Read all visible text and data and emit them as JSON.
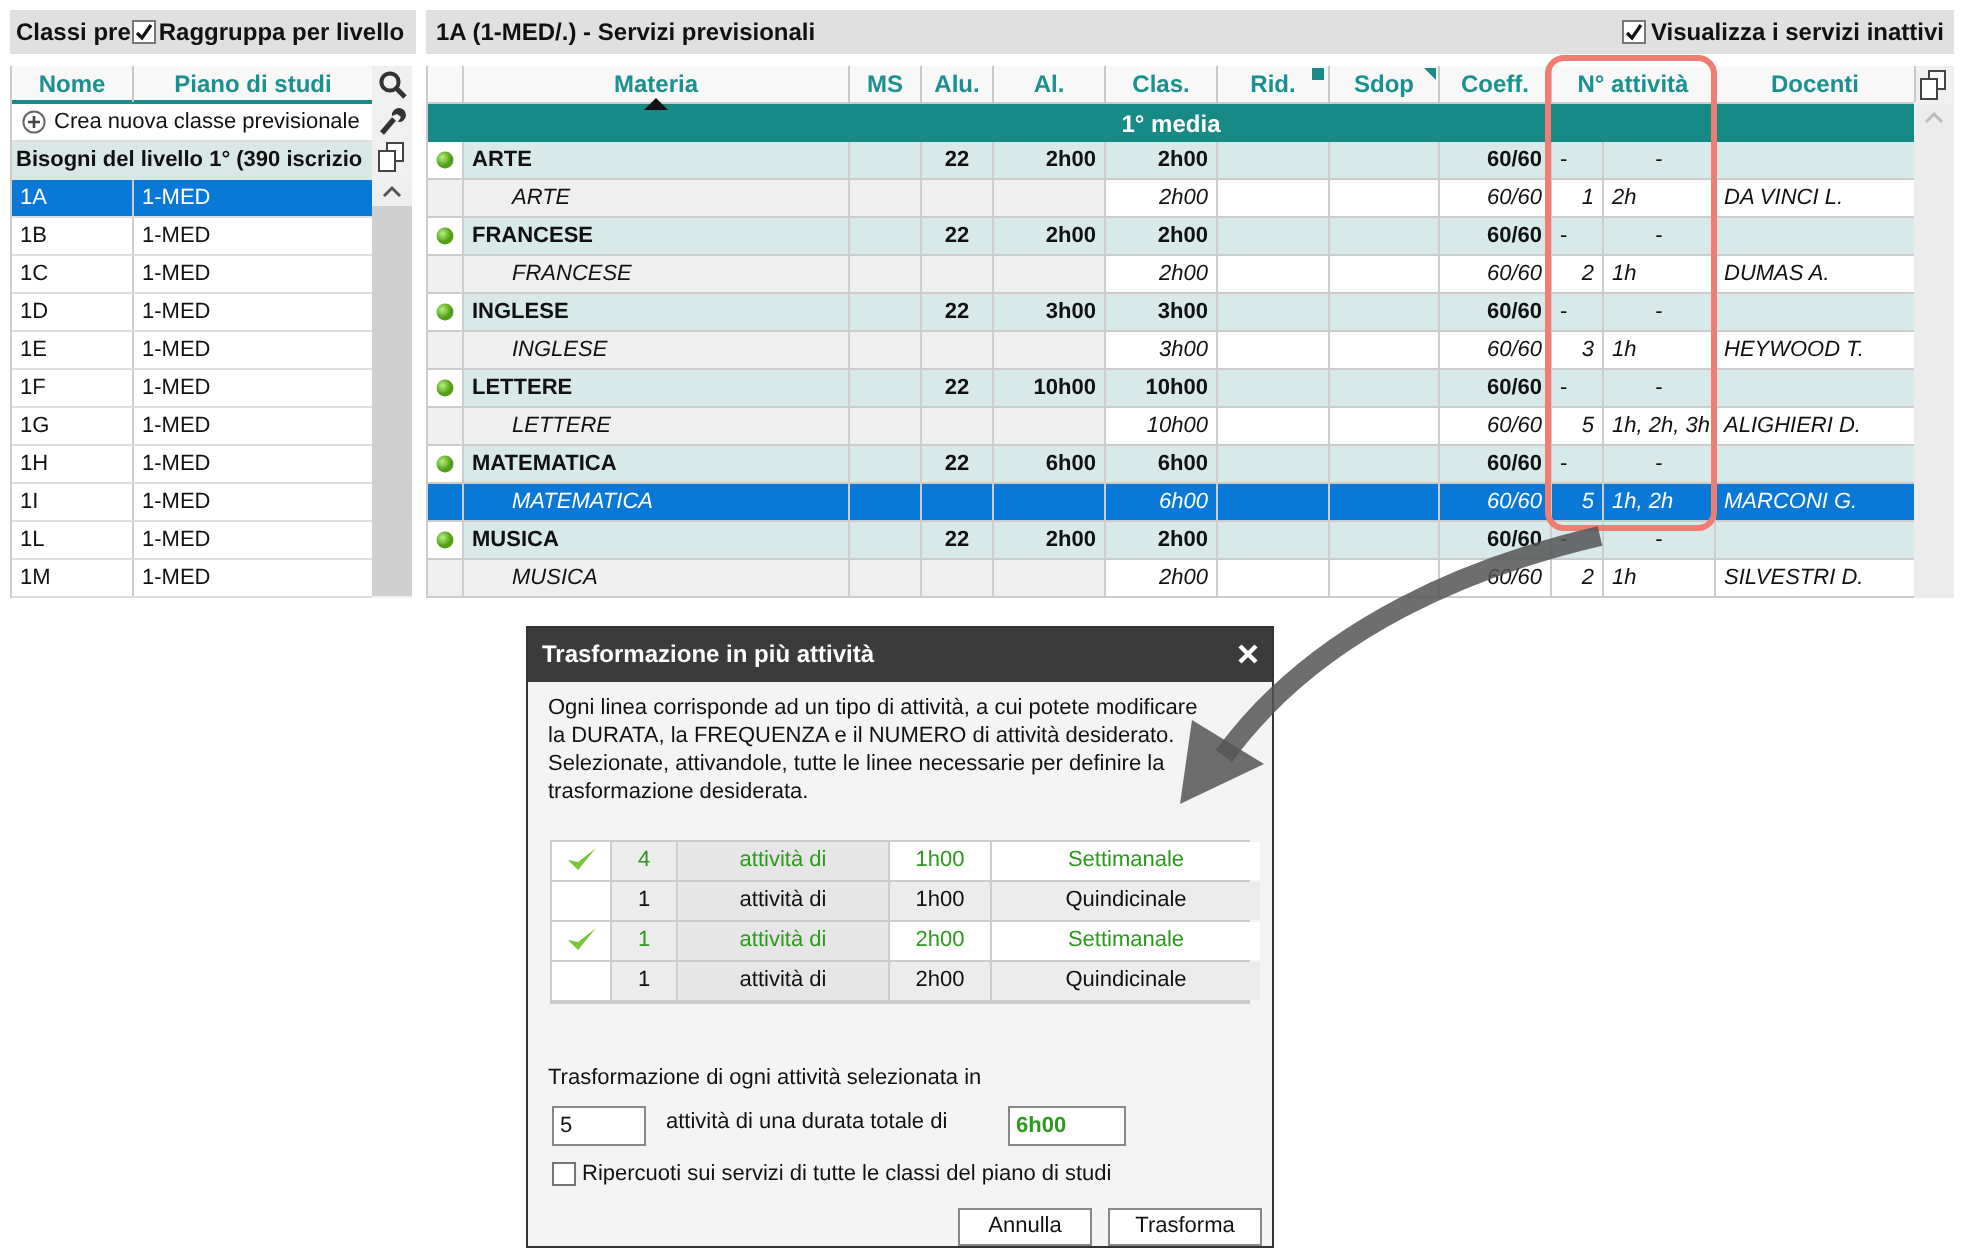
{
  "left_panel": {
    "title": "Classi pre",
    "group_checkbox": {
      "label": "Raggruppa per livello",
      "checked": true
    },
    "columns": [
      "Nome",
      "Piano di studi"
    ],
    "create_button": "Crea nuova classe previsionale",
    "group_row": "Bisogni del livello 1° (390 iscrizio",
    "rows": [
      {
        "name": "1A",
        "plan": "1-MED",
        "selected": true
      },
      {
        "name": "1B",
        "plan": "1-MED",
        "selected": false
      },
      {
        "name": "1C",
        "plan": "1-MED",
        "selected": false
      },
      {
        "name": "1D",
        "plan": "1-MED",
        "selected": false
      },
      {
        "name": "1E",
        "plan": "1-MED",
        "selected": false
      },
      {
        "name": "1F",
        "plan": "1-MED",
        "selected": false
      },
      {
        "name": "1G",
        "plan": "1-MED",
        "selected": false
      },
      {
        "name": "1H",
        "plan": "1-MED",
        "selected": false
      },
      {
        "name": "1I",
        "plan": "1-MED",
        "selected": false
      },
      {
        "name": "1L",
        "plan": "1-MED",
        "selected": false
      },
      {
        "name": "1M",
        "plan": "1-MED",
        "selected": false
      }
    ]
  },
  "right_panel": {
    "title": "1A (1-MED/.) - Servizi previsionali",
    "inactive_checkbox": {
      "label": "Visualizza i servizi inattivi",
      "checked": true
    },
    "columns": [
      "Materia",
      "MS",
      "Alu.",
      "Al.",
      "Clas.",
      "Rid.",
      "Sdop",
      "Coeff.",
      "N° attività",
      "Docenti"
    ],
    "group_header": "1° media",
    "rows": [
      {
        "kind": "subject",
        "subject": "ARTE",
        "alu": "22",
        "al": "2h00",
        "clas": "2h00",
        "coeff": "60/60",
        "count": "-",
        "durations": "-",
        "selected": false
      },
      {
        "kind": "service",
        "subject": "ARTE",
        "clas": "2h00",
        "coeff": "60/60",
        "count": "1",
        "durations": "2h",
        "teacher": "DA VINCI L.",
        "selected": false
      },
      {
        "kind": "subject",
        "subject": "FRANCESE",
        "alu": "22",
        "al": "2h00",
        "clas": "2h00",
        "coeff": "60/60",
        "count": "-",
        "durations": "-",
        "selected": false
      },
      {
        "kind": "service",
        "subject": "FRANCESE",
        "clas": "2h00",
        "coeff": "60/60",
        "count": "2",
        "durations": "1h",
        "teacher": "DUMAS A.",
        "selected": false
      },
      {
        "kind": "subject",
        "subject": "INGLESE",
        "alu": "22",
        "al": "3h00",
        "clas": "3h00",
        "coeff": "60/60",
        "count": "-",
        "durations": "-",
        "selected": false
      },
      {
        "kind": "service",
        "subject": "INGLESE",
        "clas": "3h00",
        "coeff": "60/60",
        "count": "3",
        "durations": "1h",
        "teacher": "HEYWOOD T.",
        "selected": false
      },
      {
        "kind": "subject",
        "subject": "LETTERE",
        "alu": "22",
        "al": "10h00",
        "clas": "10h00",
        "coeff": "60/60",
        "count": "-",
        "durations": "-",
        "selected": false
      },
      {
        "kind": "service",
        "subject": "LETTERE",
        "clas": "10h00",
        "coeff": "60/60",
        "count": "5",
        "durations": "1h, 2h, 3h",
        "teacher": "ALIGHIERI D.",
        "selected": false
      },
      {
        "kind": "subject",
        "subject": "MATEMATICA",
        "alu": "22",
        "al": "6h00",
        "clas": "6h00",
        "coeff": "60/60",
        "count": "-",
        "durations": "-",
        "selected": false
      },
      {
        "kind": "service",
        "subject": "MATEMATICA",
        "clas": "6h00",
        "coeff": "60/60",
        "count": "5",
        "durations": "1h, 2h",
        "teacher": "MARCONI G.",
        "selected": true
      },
      {
        "kind": "subject",
        "subject": "MUSICA",
        "alu": "22",
        "al": "2h00",
        "clas": "2h00",
        "coeff": "60/60",
        "count": "-",
        "durations": "-",
        "selected": false
      },
      {
        "kind": "service",
        "subject": "MUSICA",
        "clas": "2h00",
        "coeff": "60/60",
        "count": "2",
        "durations": "1h",
        "teacher": "SILVESTRI D.",
        "selected": false
      }
    ]
  },
  "dialog": {
    "title": "Trasformazione in più attività",
    "description": "Ogni linea corrisponde ad un tipo di attività, a cui potete modificare la DURATA, la FREQUENZA e il NUMERO di attività desiderato. Selezionate, attivandole, tutte le linee necessarie per definire la trasformazione desiderata.",
    "options": [
      {
        "checked": true,
        "count": "4",
        "label": "attività di",
        "duration": "1h00",
        "frequency": "Settimanale"
      },
      {
        "checked": false,
        "count": "1",
        "label": "attività di",
        "duration": "1h00",
        "frequency": "Quindicinale"
      },
      {
        "checked": true,
        "count": "1",
        "label": "attività di",
        "duration": "2h00",
        "frequency": "Settimanale"
      },
      {
        "checked": false,
        "count": "1",
        "label": "attività di",
        "duration": "2h00",
        "frequency": "Quindicinale"
      }
    ],
    "summary_label": "Trasformazione di ogni attività selezionata in",
    "count_value": "5",
    "middle_text": "attività di una durata totale di",
    "total_value": "6h00",
    "apply_all": {
      "label": "Ripercuoti sui servizi di tutte le classi del piano di studi",
      "checked": false
    },
    "buttons": [
      "Annulla",
      "Trasforma"
    ]
  }
}
